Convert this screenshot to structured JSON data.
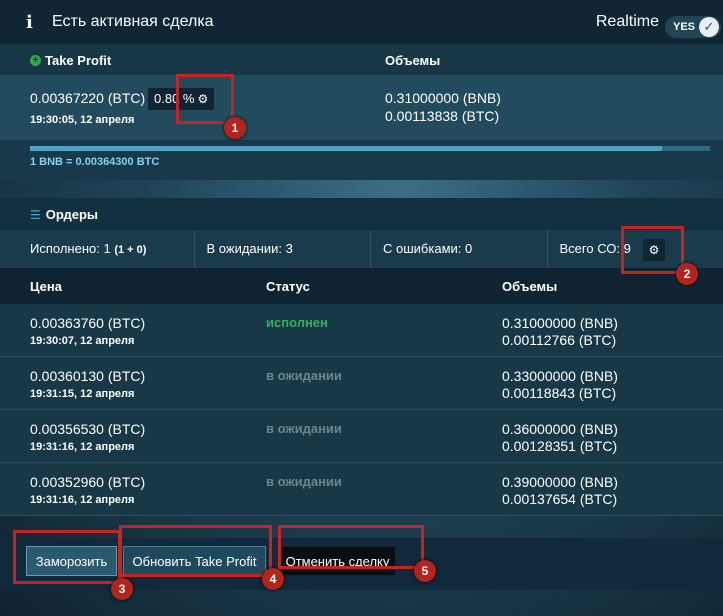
{
  "header": {
    "title": "Есть активная сделка",
    "realtime_label": "Realtime",
    "toggle_label": "YES",
    "toggle_state": "on"
  },
  "take_profit": {
    "title": "Take Profit",
    "volumes_title": "Объемы",
    "price": "0.00367220 (BTC)",
    "percent": "0.80 %",
    "time": "19:30:05, 12 апреля",
    "vol_bnb": "0.31000000 (BNB)",
    "vol_btc": "0.00113838 (BTC)",
    "progress": 0.93,
    "rate": "1 BNB = 0.00364300 BTC"
  },
  "orders": {
    "title": "Ордеры",
    "stats": {
      "done_label": "Исполнено: 1",
      "done_detail": "(1 + 0)",
      "waiting": "В ожидании: 3",
      "errors": "С ошибками: 0",
      "total": "Всего СО: 9"
    },
    "columns": {
      "price": "Цена",
      "status": "Статус",
      "volumes": "Объемы"
    },
    "rows": [
      {
        "price": "0.00363760 (BTC)",
        "time": "19:30:07, 12 апреля",
        "status": "исполнен",
        "bnb": "0.31000000 (BNB)",
        "btc": "0.00112766 (BTC)"
      },
      {
        "price": "0.00360130 (BTC)",
        "time": "19:31:15, 12 апреля",
        "status": "в ожидании",
        "bnb": "0.33000000 (BNB)",
        "btc": "0.00118843 (BTC)"
      },
      {
        "price": "0.00356530 (BTC)",
        "time": "19:31:16, 12 апреля",
        "status": "в ожидании",
        "bnb": "0.36000000 (BNB)",
        "btc": "0.00128351 (BTC)"
      },
      {
        "price": "0.00352960 (BTC)",
        "time": "19:31:16, 12 апреля",
        "status": "в ожидании",
        "bnb": "0.39000000 (BNB)",
        "btc": "0.00137654 (BTC)"
      }
    ]
  },
  "buttons": {
    "freeze": "Заморозить",
    "update_tp": "Обновить Take Profit",
    "cancel": "Отменить сделку"
  },
  "annotations": [
    "1",
    "2",
    "3",
    "4",
    "5"
  ],
  "colors": {
    "highlight": "#c62323",
    "status_done": "#2fb35a",
    "status_waiting": "#6c8590"
  },
  "icons": {
    "info": "info-icon",
    "plus": "plus-circle-icon",
    "gear": "gear-icon",
    "list": "list-icon",
    "check": "check-icon"
  }
}
